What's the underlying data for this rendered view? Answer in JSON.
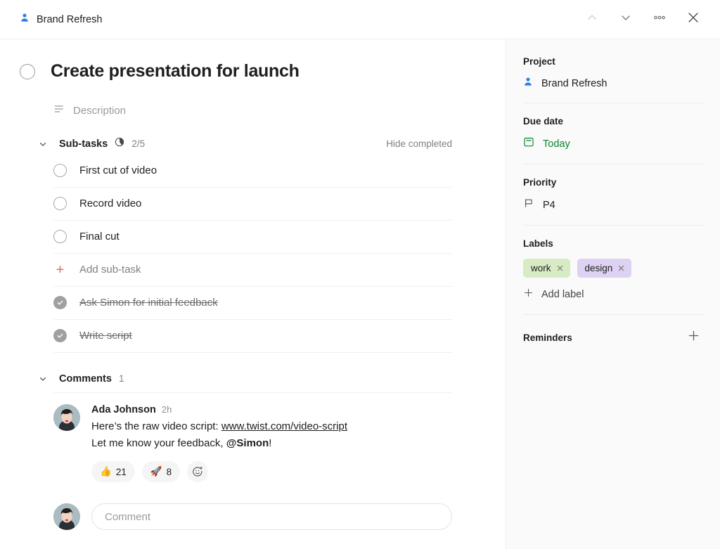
{
  "topbar": {
    "project_icon": "person-icon",
    "project_name": "Brand Refresh",
    "actions": [
      {
        "name": "previous-task-button",
        "icon": "chevron-up-icon"
      },
      {
        "name": "next-task-button",
        "icon": "chevron-down-icon"
      },
      {
        "name": "more-options-button",
        "icon": "more-horizontal-icon"
      },
      {
        "name": "close-button",
        "icon": "close-icon"
      }
    ]
  },
  "task": {
    "title": "Create presentation for launch",
    "completed": false,
    "description_placeholder": "Description",
    "description_icon": "description-lines-icon"
  },
  "subtasks_section": {
    "title": "Sub-tasks",
    "progress_text": "2/5",
    "progress_done": 2,
    "progress_total": 5,
    "hide_completed_label": "Hide completed",
    "add_label": "Add sub-task",
    "items": [
      {
        "label": "First cut of video",
        "completed": false
      },
      {
        "label": "Record video",
        "completed": false
      },
      {
        "label": "Final cut",
        "completed": false
      },
      {
        "label": "Ask Simon for initial feedback",
        "completed": true
      },
      {
        "label": "Write script",
        "completed": true
      }
    ]
  },
  "comments_section": {
    "title": "Comments",
    "count": "1",
    "comment": {
      "author": "Ada Johnson",
      "time": "2h",
      "line1_prefix": "Here’s the raw video script: ",
      "line1_link": "www.twist.com/video-script",
      "line2_prefix": "Let me know your feedback, ",
      "line2_mention": "@Simon",
      "line2_suffix": "!",
      "reactions": [
        {
          "emoji": "👍",
          "count": "21",
          "name": "reaction-thumbs-up"
        },
        {
          "emoji": "🚀",
          "count": "8",
          "name": "reaction-rocket"
        }
      ],
      "add_reaction_icon": "add-reaction-icon"
    },
    "composer_placeholder": "Comment",
    "composer_value": ""
  },
  "sidebar": {
    "project": {
      "title": "Project",
      "icon": "person-icon",
      "value": "Brand Refresh"
    },
    "due_date": {
      "title": "Due date",
      "icon": "calendar-icon",
      "value": "Today",
      "color": "#058527"
    },
    "priority": {
      "title": "Priority",
      "icon": "flag-icon",
      "value": "P4"
    },
    "labels": {
      "title": "Labels",
      "add_label": "Add label",
      "items": [
        {
          "name": "work",
          "bg": "#d7ecc5",
          "remove_icon": "close-icon"
        },
        {
          "name": "design",
          "bg": "#ddd2f2",
          "remove_icon": "close-icon"
        }
      ]
    },
    "reminders": {
      "title": "Reminders",
      "add_icon": "plus-icon"
    }
  },
  "colors": {
    "accent_red": "#e2725b",
    "accent_blue": "#2b7de9",
    "accent_green": "#058527",
    "sidebar_bg": "#fafafa",
    "border": "#eeeeee"
  }
}
